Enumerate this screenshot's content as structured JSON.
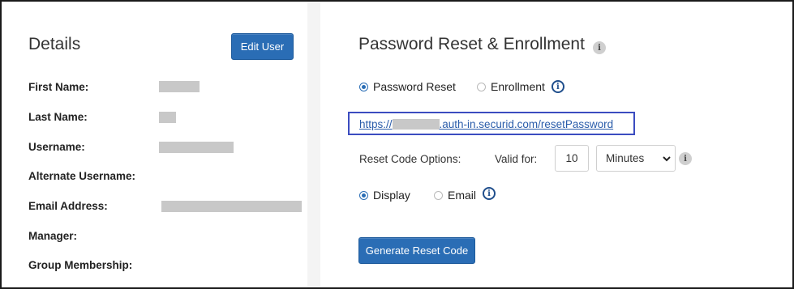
{
  "details": {
    "title": "Details",
    "edit_button": "Edit User",
    "fields": [
      {
        "label": "First Name:"
      },
      {
        "label": "Last Name:"
      },
      {
        "label": "Username:"
      },
      {
        "label": "Alternate Username:"
      },
      {
        "label": "Email Address:"
      },
      {
        "label": "Manager:"
      },
      {
        "label": "Group Membership:"
      }
    ]
  },
  "reset": {
    "title": "Password Reset & Enrollment",
    "info_glyph": "i",
    "mode_options": {
      "password_reset": "Password Reset",
      "enrollment": "Enrollment",
      "selected": "Password Reset"
    },
    "link": {
      "prefix": "https://",
      "suffix": ".auth-in.securid.com/resetPassword"
    },
    "code_options_label": "Reset Code Options:",
    "valid_for_label": "Valid for:",
    "valid_for_value": "10",
    "unit_selected": "Minutes",
    "delivery_options": {
      "display": "Display",
      "email": "Email",
      "selected": "Display"
    },
    "generate_button": "Generate Reset Code"
  },
  "colors": {
    "accent": "#2a6db5",
    "link": "#2a5caa",
    "highlight_box": "#3b4cc0"
  },
  "icons": [
    "info-icon",
    "chevron-down-icon"
  ]
}
